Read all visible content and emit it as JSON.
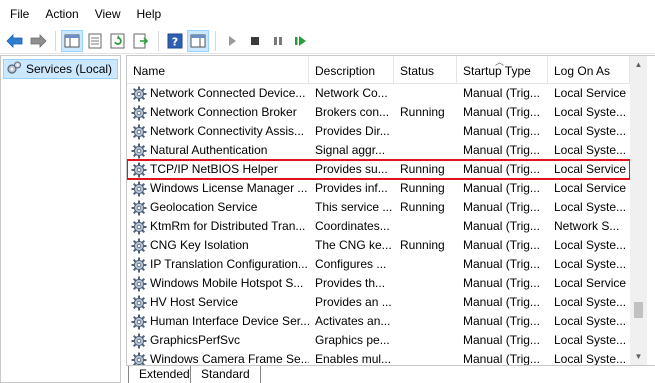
{
  "menu": [
    "File",
    "Action",
    "View",
    "Help"
  ],
  "toolbar": {
    "buttons": [
      "back-arrow",
      "forward-arrow",
      "show-hide-console-tree",
      "properties",
      "refresh",
      "export-list",
      "help",
      "show-hide-action-pane",
      "start-service",
      "stop-service",
      "pause-service",
      "restart-service"
    ]
  },
  "tree": {
    "root_label": "Services (Local)"
  },
  "columns": [
    "Name",
    "Description",
    "Status",
    "Startup Type",
    "Log On As"
  ],
  "services": [
    {
      "name": "Network Connected Device...",
      "description": "Network Co...",
      "status": "",
      "startup": "Manual (Trig...",
      "logon": "Local Service"
    },
    {
      "name": "Network Connection Broker",
      "description": "Brokers con...",
      "status": "Running",
      "startup": "Manual (Trig...",
      "logon": "Local Syste..."
    },
    {
      "name": "Network Connectivity Assis...",
      "description": "Provides Dir...",
      "status": "",
      "startup": "Manual (Trig...",
      "logon": "Local Syste..."
    },
    {
      "name": "Natural Authentication",
      "description": "Signal aggr...",
      "status": "",
      "startup": "Manual (Trig...",
      "logon": "Local Syste..."
    },
    {
      "name": "TCP/IP NetBIOS Helper",
      "description": "Provides su...",
      "status": "Running",
      "startup": "Manual (Trig...",
      "logon": "Local Service"
    },
    {
      "name": "Windows License Manager ...",
      "description": "Provides inf...",
      "status": "Running",
      "startup": "Manual (Trig...",
      "logon": "Local Service"
    },
    {
      "name": "Geolocation Service",
      "description": "This service ...",
      "status": "Running",
      "startup": "Manual (Trig...",
      "logon": "Local Syste..."
    },
    {
      "name": "KtmRm for Distributed Tran...",
      "description": "Coordinates...",
      "status": "",
      "startup": "Manual (Trig...",
      "logon": "Network S..."
    },
    {
      "name": "CNG Key Isolation",
      "description": "The CNG ke...",
      "status": "Running",
      "startup": "Manual (Trig...",
      "logon": "Local Syste..."
    },
    {
      "name": "IP Translation Configuration...",
      "description": "Configures ...",
      "status": "",
      "startup": "Manual (Trig...",
      "logon": "Local Syste..."
    },
    {
      "name": "Windows Mobile Hotspot S...",
      "description": "Provides th...",
      "status": "",
      "startup": "Manual (Trig...",
      "logon": "Local Service"
    },
    {
      "name": "HV Host Service",
      "description": "Provides an ...",
      "status": "",
      "startup": "Manual (Trig...",
      "logon": "Local Syste..."
    },
    {
      "name": "Human Interface Device Ser...",
      "description": "Activates an...",
      "status": "",
      "startup": "Manual (Trig...",
      "logon": "Local Syste..."
    },
    {
      "name": "GraphicsPerfSvc",
      "description": "Graphics pe...",
      "status": "",
      "startup": "Manual (Trig...",
      "logon": "Local Syste..."
    },
    {
      "name": "Windows Camera Frame Se...",
      "description": "Enables mul...",
      "status": "",
      "startup": "Manual (Trig...",
      "logon": "Local Syste..."
    }
  ],
  "highlighted_row_index": 4,
  "highlight_color": "#e0141e",
  "tabs": [
    "Extended",
    "Standard"
  ]
}
